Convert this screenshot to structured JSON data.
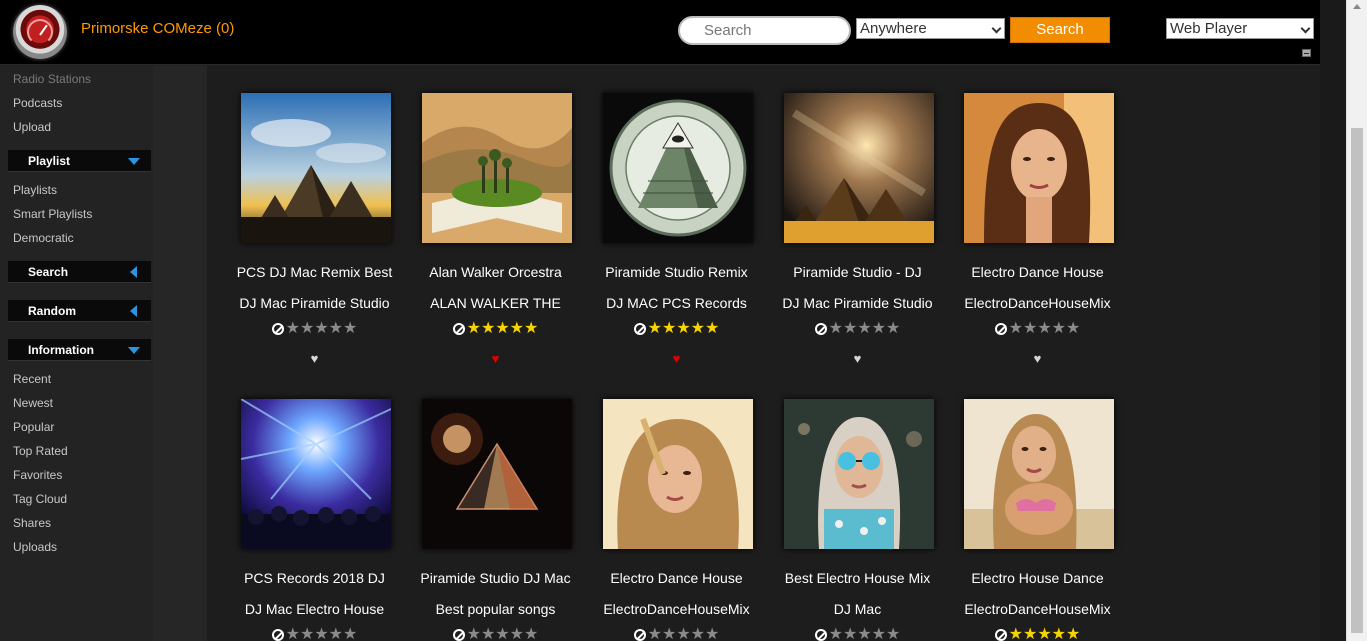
{
  "header": {
    "site_title": "Primorske COMeze (0)",
    "search_placeholder": "Search",
    "scope_value": "Anywhere",
    "search_button": "Search",
    "player_value": "Web Player"
  },
  "sidebar": {
    "top_links": [
      "Radio Stations",
      "Podcasts",
      "Upload"
    ],
    "sections": {
      "playlist": {
        "label": "Playlist",
        "items": [
          "Playlists",
          "Smart Playlists",
          "Democratic"
        ]
      },
      "search": {
        "label": "Search"
      },
      "random": {
        "label": "Random"
      },
      "information": {
        "label": "Information",
        "items": [
          "Recent",
          "Newest",
          "Popular",
          "Top Rated",
          "Favorites",
          "Tag Cloud",
          "Shares",
          "Uploads"
        ]
      }
    }
  },
  "albums": [
    {
      "title": "PCS DJ Mac Remix Best",
      "artist": "DJ Mac Piramide Studio",
      "rating": 0,
      "favorite": false,
      "art": "pyramids-sky"
    },
    {
      "title": "Alan Walker Orcestra",
      "artist": "ALAN WALKER THE",
      "rating": 5,
      "favorite": true,
      "art": "book-landscape"
    },
    {
      "title": "Piramide Studio Remix",
      "artist": "DJ MAC PCS Records",
      "rating": 5,
      "favorite": true,
      "art": "dollar-pyramid"
    },
    {
      "title": "Piramide Studio - DJ",
      "artist": "DJ Mac Piramide Studio",
      "rating": 0,
      "favorite": false,
      "art": "pyramids-galaxy"
    },
    {
      "title": "Electro Dance House",
      "artist": "ElectroDanceHouseMix",
      "rating": 0,
      "favorite": false,
      "art": "portrait-warm"
    },
    {
      "title": "PCS Records 2018 DJ",
      "artist": "DJ Mac Electro House",
      "rating": 0,
      "favorite": false,
      "art": "concert-lights"
    },
    {
      "title": "Piramide Studio DJ Mac",
      "artist": "Best popular songs",
      "rating": 0,
      "favorite": false,
      "art": "glass-pyramid"
    },
    {
      "title": "Electro Dance House",
      "artist": "ElectroDanceHouseMix",
      "rating": 0,
      "favorite": false,
      "art": "portrait-sunlight"
    },
    {
      "title": "Best Electro House Mix",
      "artist": "DJ Mac",
      "rating": 0,
      "favorite": false,
      "art": "portrait-sunglasses"
    },
    {
      "title": "Electro House Dance",
      "artist": "ElectroDanceHouseMix",
      "rating": 5,
      "favorite": false,
      "art": "portrait-beach"
    }
  ]
}
